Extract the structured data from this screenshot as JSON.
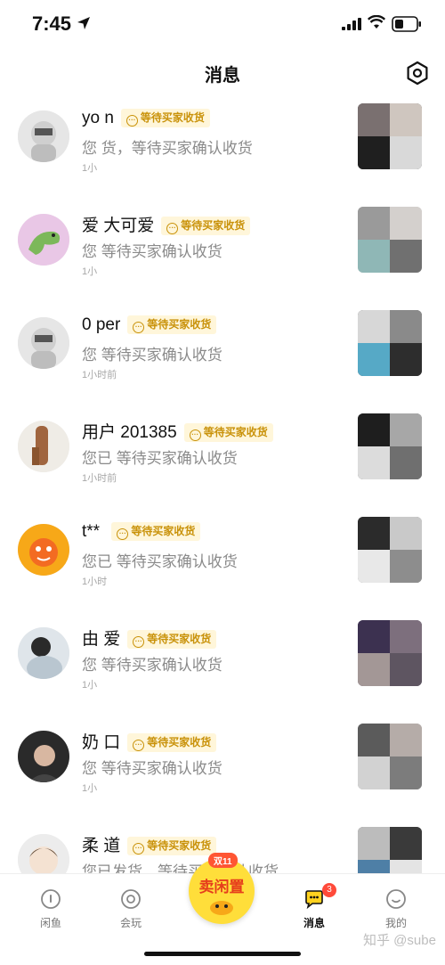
{
  "status": {
    "time": "7:45"
  },
  "header": {
    "title": "消息"
  },
  "messages": [
    {
      "name": "yo  n",
      "badge": "等待买家收货",
      "preview": "您   货，等待买家确认收货",
      "time": "1小"
    },
    {
      "name": "爱      大可爱",
      "badge": "等待买家收货",
      "preview": "您    等待买家确认收货",
      "time": "1小"
    },
    {
      "name": "0     per",
      "badge": "等待买家收货",
      "preview": "您    等待买家确认收货",
      "time": "1小时前"
    },
    {
      "name": "用户   201385",
      "badge": "等待买家收货",
      "preview": "您已   等待买家确认收货",
      "time": "1小时前"
    },
    {
      "name": "t**   ",
      "badge": "等待买家收货",
      "preview": "您已   等待买家确认收货",
      "time": "1小时"
    },
    {
      "name": "由    爱",
      "badge": "等待买家收货",
      "preview": "您    等待买家确认收货",
      "time": "1小"
    },
    {
      "name": "奶    口",
      "badge": "等待买家收货",
      "preview": "您    等待买家确认收货",
      "time": "1小"
    },
    {
      "name": "柔    道",
      "badge": "等待买家收货",
      "preview": "您已发货，等待买家确认收货",
      "time": ""
    }
  ],
  "tabbar": {
    "tabs": [
      {
        "label": "闲鱼"
      },
      {
        "label": "会玩"
      },
      {
        "label": "消息"
      },
      {
        "label": "我的"
      }
    ],
    "center": {
      "top": "双11",
      "main": "卖闲置"
    },
    "unread_count": "3"
  },
  "watermark": "知乎 @sube"
}
